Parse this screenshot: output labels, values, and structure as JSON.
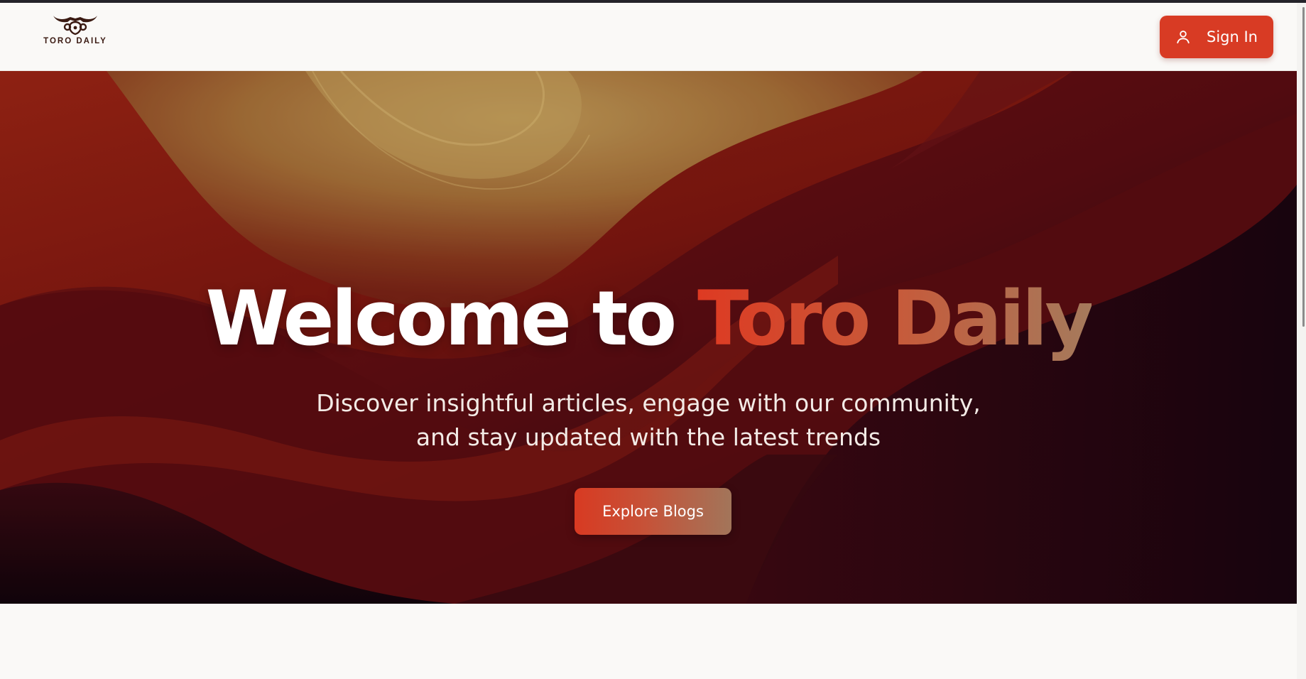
{
  "brand": {
    "logo_text": "TORO DAILY",
    "logo_icon": "bull-horns-icon",
    "logo_color": "#3a1a12"
  },
  "header": {
    "signin_label": "Sign In",
    "signin_icon": "user-icon",
    "signin_color": "#d83b24"
  },
  "hero": {
    "title_prefix": "Welcome to",
    "title_accent": "Toro Daily",
    "subtitle": "Discover insightful articles, engage with our community, and stay updated with the latest trends",
    "cta_label": "Explore Blogs",
    "colors": {
      "accent_start": "#de3a22",
      "accent_end": "#a57a5c",
      "background_dark": "#2a0810",
      "background_red": "#8a1a10",
      "background_gold": "#b08a4a"
    }
  }
}
